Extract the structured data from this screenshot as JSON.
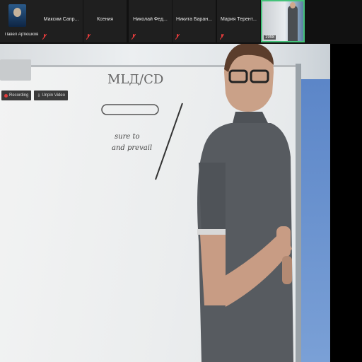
{
  "participants": [
    {
      "name": "Павел Артюшков",
      "mic": "muted"
    },
    {
      "name": "Максим Сапр...",
      "mic": "muted"
    },
    {
      "name": "Ксения",
      "mic": "muted"
    },
    {
      "name": "Николай Фед...",
      "mic": "muted"
    },
    {
      "name": "Никита Баран...",
      "mic": "muted"
    },
    {
      "name": "Мария Терент...",
      "mic": "muted"
    }
  ],
  "self_view": {
    "tag": "1998"
  },
  "toolbar": {
    "recording_label": "Recording",
    "unpin_label": "Unpin Video"
  },
  "whiteboard": {
    "heading": "МLД/CD",
    "note_line1": "sure to",
    "note_line2": "and prevail"
  },
  "colors": {
    "accent_active_speaker": "#44c27a",
    "muted_mic": "#e23b3b"
  }
}
